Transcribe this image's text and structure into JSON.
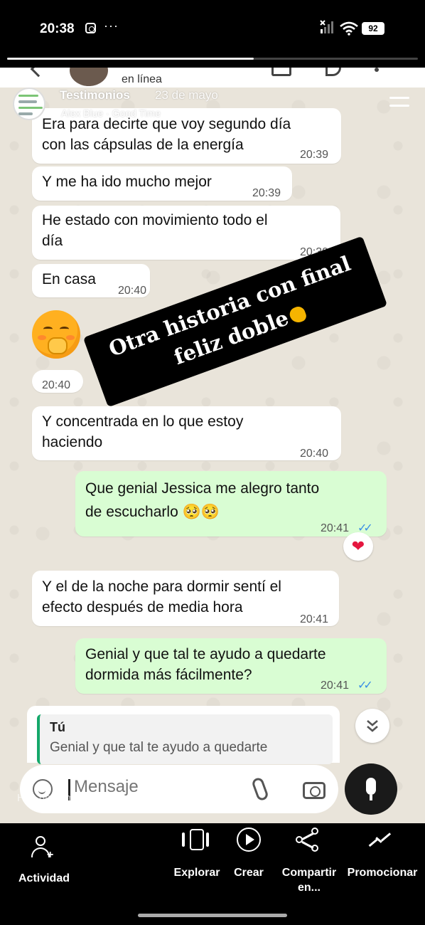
{
  "status_bar": {
    "time": "20:38",
    "more": "···",
    "battery": "92"
  },
  "story": {
    "progress": 0.6,
    "username": "Testimonios",
    "date": "23 de mayo",
    "music": "Alex Blue · Good Time"
  },
  "chat_header": {
    "status": "en línea"
  },
  "messages": [
    {
      "dir": "in",
      "lines": [
        "Era para decirte que voy segundo día",
        "con las cápsulas de la energía"
      ],
      "time": "20:39"
    },
    {
      "dir": "in",
      "lines": [
        "Y me ha ido mucho mejor"
      ],
      "time": "20:39"
    },
    {
      "dir": "in",
      "lines": [
        "He estado con movimiento todo el",
        "día"
      ],
      "time": "20:39"
    },
    {
      "dir": "in",
      "lines": [
        "En casa"
      ],
      "time": "20:40"
    },
    {
      "dir": "in",
      "lines": [
        ""
      ],
      "time": "20:40",
      "emoji": "face-with-hand-over-mouth"
    },
    {
      "dir": "in",
      "lines": [
        "Y concentrada en lo que estoy",
        "haciendo"
      ],
      "time": "20:40"
    },
    {
      "dir": "out",
      "lines": [
        "Que genial Jessica me alegro tanto",
        "de escucharlo 🥺🥺"
      ],
      "time": "20:41",
      "ticks": "✓✓",
      "reaction": "❤"
    },
    {
      "dir": "in",
      "lines": [
        "Y el de la noche para dormir sentí el",
        "efecto después de media hora"
      ],
      "time": "20:41"
    },
    {
      "dir": "out",
      "lines": [
        "Genial y que tal te ayudo a quedarte",
        "dormida más fácilmente?"
      ],
      "time": "20:41",
      "ticks": "✓✓"
    }
  ],
  "sticker": {
    "line1": "Otra historia con final",
    "line2": "feliz doble"
  },
  "reply": {
    "name": "Tú",
    "text": "Genial y que tal te ayudo a quedarte"
  },
  "compose": {
    "placeholder": "Mensaje",
    "comment_hint": "Haz un comentario..."
  },
  "bottom_nav": {
    "items": [
      {
        "label": "Actividad",
        "icon": "activity-icon"
      },
      {
        "label": "Explorar",
        "icon": "explore-icon"
      },
      {
        "label": "Crear",
        "icon": "create-icon"
      },
      {
        "label": "Compartir en...",
        "icon": "share-icon"
      },
      {
        "label": "Promocionar",
        "icon": "promote-icon"
      }
    ]
  },
  "colors": {
    "incoming": "#ffffff",
    "outgoing": "#d9fdd3",
    "tick": "#3a8ee6",
    "heart": "#e5173f"
  }
}
